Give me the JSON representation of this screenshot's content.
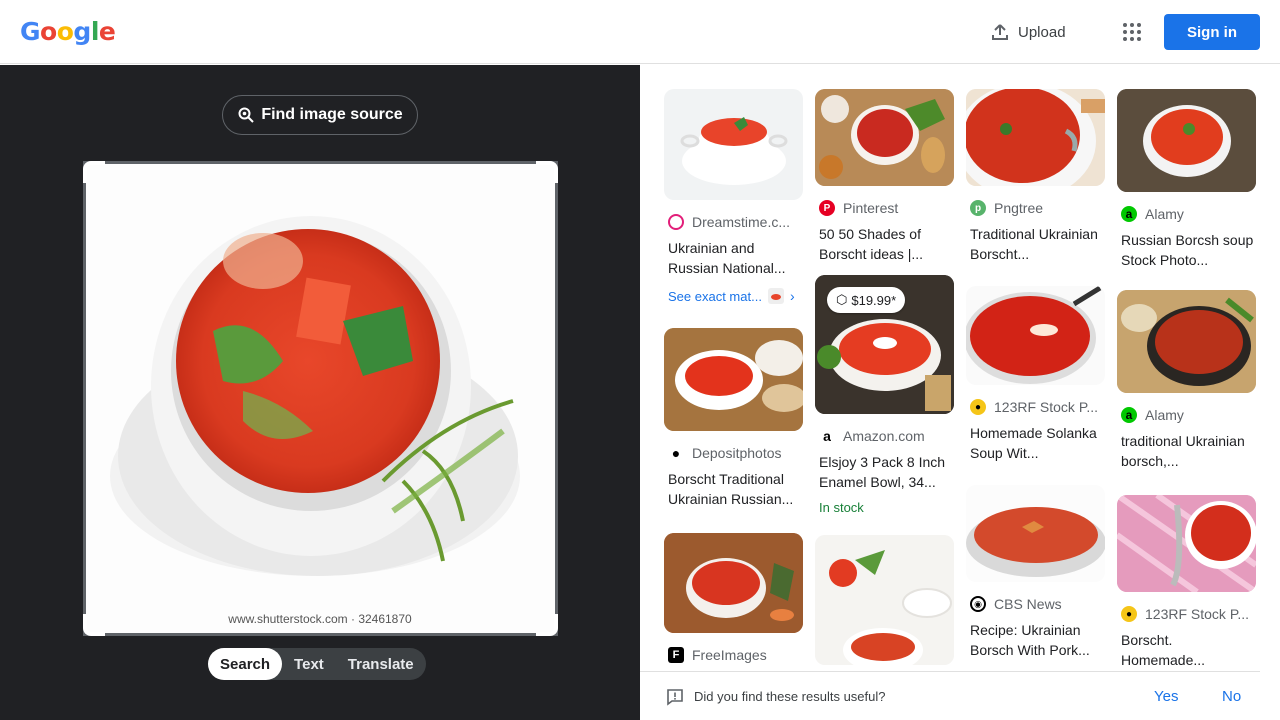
{
  "header": {
    "logo": "Google",
    "upload_label": "Upload",
    "signin_label": "Sign in",
    "colors": {
      "accent": "#1a73e8"
    }
  },
  "left_panel": {
    "find_source_label": "Find image source",
    "query_watermark": "www.shutterstock.com · 32461870",
    "modes": [
      {
        "label": "Search",
        "active": true
      },
      {
        "label": "Text",
        "active": false
      },
      {
        "label": "Translate",
        "active": false
      }
    ]
  },
  "results": [
    {
      "source": "Dreamstime.c...",
      "title": "Ukrainian and Russian National...",
      "favicon": "dreamstime",
      "exact_label": "See exact mat..."
    },
    {
      "source": "Depositphotos",
      "title": "Borscht Traditional Ukrainian Russian...",
      "favicon": "depositphotos"
    },
    {
      "source": "FreeImages",
      "title": "",
      "favicon": "freeimages"
    },
    {
      "source": "Pinterest",
      "title": "50 50 Shades of Borscht ideas |...",
      "favicon": "pinterest"
    },
    {
      "source": "Amazon.com",
      "title": "Elsjoy 3 Pack 8 Inch Enamel Bowl, 34...",
      "favicon": "amazon",
      "price": "$19.99*",
      "stock": "In stock"
    },
    {
      "source": "",
      "title": "",
      "favicon": ""
    },
    {
      "source": "Pngtree",
      "title": "Traditional Ukrainian Borscht...",
      "favicon": "pngtree"
    },
    {
      "source": "123RF Stock P...",
      "title": "Homemade Solanka Soup Wit...",
      "favicon": "123rf"
    },
    {
      "source": "CBS News",
      "title": "Recipe: Ukrainian Borsch With Pork...",
      "favicon": "cbs"
    },
    {
      "source": "Alamy",
      "title": "Russian Borcsh soup Stock Photo...",
      "favicon": "alamy"
    },
    {
      "source": "Alamy",
      "title": "traditional Ukrainian borsch,...",
      "favicon": "alamy"
    },
    {
      "source": "123RF Stock P...",
      "title": "Borscht. Homemade...",
      "favicon": "123rf"
    }
  ],
  "feedback": {
    "question": "Did you find these results useful?",
    "yes_label": "Yes",
    "no_label": "No"
  }
}
